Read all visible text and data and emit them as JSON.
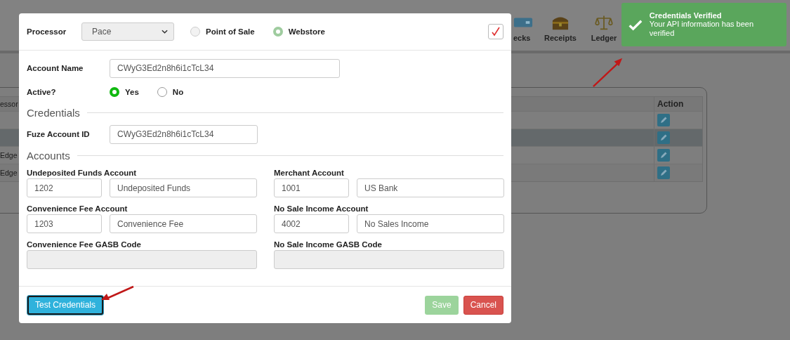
{
  "nav": [
    {
      "label": "ecks",
      "kind": "checks"
    },
    {
      "label": "Receipts",
      "kind": "chest"
    },
    {
      "label": "Ledger",
      "kind": "scale"
    }
  ],
  "table": {
    "columns": [
      "essor",
      "Action"
    ],
    "rows": [
      {
        "column_1": null,
        "selected": false
      },
      {
        "column_1": null,
        "selected": true
      },
      {
        "column_1": "Edge",
        "selected": false
      },
      {
        "column_1": "Edge",
        "selected": false
      }
    ]
  },
  "toast": {
    "title": "Credentials Verified",
    "message": "Your API information has been verified"
  },
  "modal": {
    "processor": {
      "label": "Processor",
      "value": "Pace",
      "options": [
        {
          "label": "Point of Sale",
          "selected": false,
          "disabled": true
        },
        {
          "label": "Webstore",
          "selected": true,
          "disabled": true
        }
      ]
    },
    "corner_checkbox": {
      "checked": true
    },
    "account_name": {
      "label": "Account Name",
      "value": "CWyG3Ed2n8h6i1cTcL34"
    },
    "active": {
      "label": "Active?",
      "options": [
        {
          "label": "Yes",
          "selected": true
        },
        {
          "label": "No",
          "selected": false
        }
      ]
    },
    "credentials": {
      "heading": "Credentials",
      "fuze_label": "Fuze Account ID",
      "fuze_value": "CWyG3Ed2n8h6i1cTcL34"
    },
    "accounts": {
      "heading": "Accounts",
      "fields": [
        {
          "label": "Undeposited Funds Account",
          "code": "1202",
          "name": "Undeposited Funds",
          "disabled": false
        },
        {
          "label": "Merchant Account",
          "code": "1001",
          "name": "US Bank",
          "disabled": false
        },
        {
          "label": "Convenience Fee Account",
          "code": "1203",
          "name": "Convenience Fee",
          "disabled": false
        },
        {
          "label": "No Sale Income Account",
          "code": "4002",
          "name": "No Sales Income",
          "disabled": false
        },
        {
          "label": "Convenience Fee GASB Code",
          "disabled": true
        },
        {
          "label": "No Sale Income GASB Code",
          "disabled": true
        }
      ]
    },
    "buttons": [
      {
        "label": "Test Credentials",
        "kind": "primary",
        "disabled": false
      },
      {
        "label": "Save",
        "kind": "success",
        "disabled": true
      },
      {
        "label": "Cancel",
        "kind": "danger",
        "disabled": false
      }
    ]
  }
}
